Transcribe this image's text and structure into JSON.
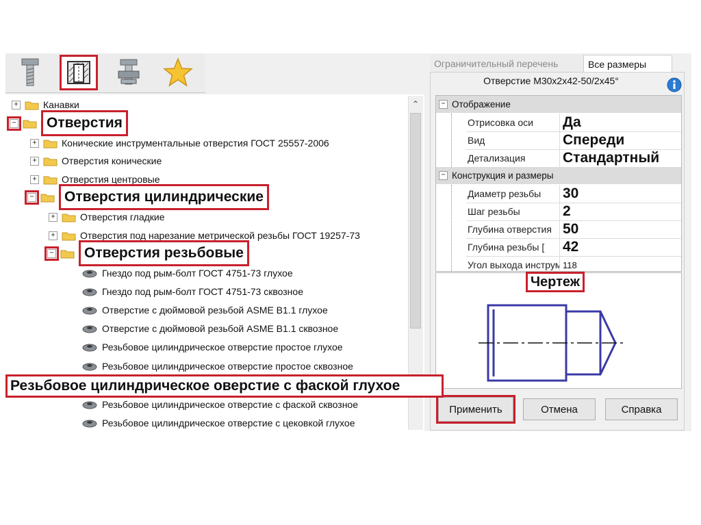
{
  "toolbar": {
    "buttons": [
      {
        "icon": "bolt-icon"
      },
      {
        "icon": "hole-section-icon",
        "selected": true
      },
      {
        "icon": "nut-bolt-icon"
      },
      {
        "icon": "star-icon"
      }
    ]
  },
  "tree": {
    "items": [
      {
        "label": "Канавки"
      },
      {
        "label": "Отверстия"
      },
      {
        "label": "Конические инструментальные отверстия ГОСТ 25557-2006"
      },
      {
        "label": "Отверстия конические"
      },
      {
        "label": "Отверстия центровые"
      },
      {
        "label": "Отверстия цилиндрические"
      },
      {
        "label": "Отверстия гладкие"
      },
      {
        "label": "Отверстия под нарезание метрической резьбы ГОСТ 19257-73"
      },
      {
        "label": "Отверстия резьбовые"
      },
      {
        "label": "Гнездо под рым-болт ГОСТ 4751-73 глухое"
      },
      {
        "label": "Гнездо под рым-болт ГОСТ 4751-73 сквозное"
      },
      {
        "label": "Отверстие с дюймовой резьбой ASME B1.1 глухое"
      },
      {
        "label": "Отверстие с дюймовой резьбой ASME B1.1 сквозное"
      },
      {
        "label": "Резьбовое цилиндрическое отверстие простое глухое"
      },
      {
        "label": "Резьбовое цилиндрическое отверстие простое сквозное"
      },
      {
        "label": "Резьбовое цилиндрическое оверстие с фаской глухое"
      },
      {
        "label": "Резьбовое цилиндрическое отверстие с фаской сквозное"
      },
      {
        "label": "Резьбовое цилиндрическое отверстие с цековкой глухое"
      }
    ]
  },
  "tabs": [
    {
      "label": "Ограничительный перечень",
      "active": false
    },
    {
      "label": "Все размеры",
      "active": true
    }
  ],
  "properties": {
    "title": "Отверстие М30х2х42-50/2х45°",
    "categories": [
      {
        "label": "Отображение",
        "rows": [
          {
            "name": "Отрисовка оси",
            "value": "Да"
          },
          {
            "name": "Вид",
            "value": "Спереди"
          },
          {
            "name": "Детализация",
            "value": "Стандартный"
          }
        ]
      },
      {
        "label": "Конструкция и размеры",
        "rows": [
          {
            "name": "Диаметр резьбы",
            "value": "30"
          },
          {
            "name": "Шаг резьбы",
            "value": "2"
          },
          {
            "name": "Глубина отверстия",
            "value": "50"
          },
          {
            "name": "Глубина резьбы [",
            "value": "42"
          },
          {
            "name": "Угол выхода инструмента",
            "value": "118"
          }
        ]
      }
    ]
  },
  "drawing": {
    "label": "Чертеж"
  },
  "buttons": {
    "apply": "Применить",
    "cancel": "Отмена",
    "help": "Справка"
  },
  "colors": {
    "highlight": "#c8202c",
    "drawing_lines": "#3a3aa6",
    "folder": "#f2c94c"
  }
}
